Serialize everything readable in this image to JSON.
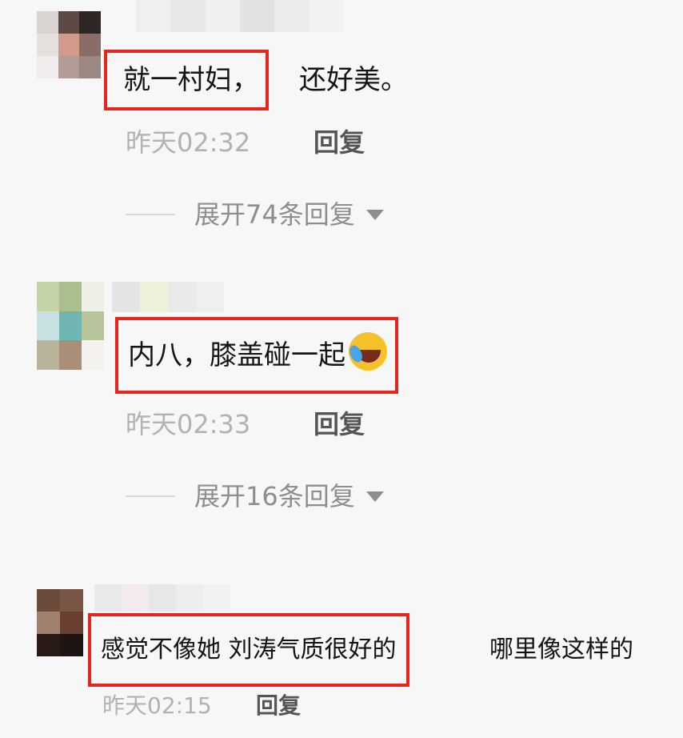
{
  "comments": [
    {
      "highlighted_text": "就一村妇，",
      "rest_text": "还好美。",
      "time": "昨天02:32",
      "reply_label": "回复",
      "expand_label": "展开74条回复"
    },
    {
      "highlighted_text": "内八，膝盖碰一起",
      "rest_text": "",
      "emoji": "rolling-on-floor-laughing-emoji",
      "time": "昨天02:33",
      "reply_label": "回复",
      "expand_label": "展开16条回复"
    },
    {
      "highlighted_text": "感觉不像她 刘涛气质很好的",
      "rest_text": "哪里像这样的",
      "time": "昨天02:15",
      "reply_label": "回复"
    }
  ],
  "colors": {
    "highlight_box": "#e8241c",
    "background": "#f7f7f7",
    "meta_text": "#b2b2b2"
  }
}
